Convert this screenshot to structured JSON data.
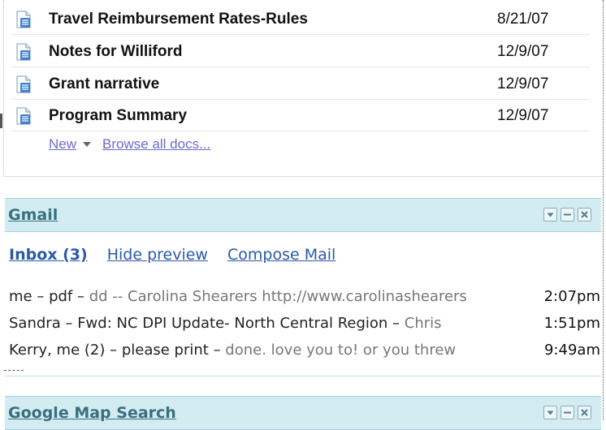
{
  "docs": {
    "items": [
      {
        "title": "Travel Reimbursement Rates-Rules",
        "date": "8/21/07"
      },
      {
        "title": "Notes for Williford",
        "date": "12/9/07"
      },
      {
        "title": "Grant narrative",
        "date": "12/9/07"
      },
      {
        "title": "Program Summary",
        "date": "12/9/07"
      }
    ],
    "new_label": "New",
    "browse_label": "Browse all docs..."
  },
  "gmail": {
    "title": "Gmail",
    "links": {
      "inbox": "Inbox (3)",
      "hide_preview": "Hide preview",
      "compose": "Compose Mail"
    },
    "messages": [
      {
        "sender": "me",
        "subject": "pdf",
        "snippet": "dd -- Carolina Shearers http://www.carolinashearers",
        "time": "2:07pm"
      },
      {
        "sender": "Sandra",
        "subject": "Fwd: NC DPI Update- North Central Region",
        "snippet": "Chris",
        "time": "1:51pm"
      },
      {
        "sender": "Kerry, me (2)",
        "subject": "please print",
        "snippet": "done. love you to! or you threw",
        "time": "9:49am"
      }
    ]
  },
  "map_search": {
    "title": "Google Map Search"
  },
  "colors": {
    "header_bg": "#d3ecf2",
    "title": "#37707f",
    "link": "#2b5aa8",
    "docs_link": "#6b6bcc"
  }
}
